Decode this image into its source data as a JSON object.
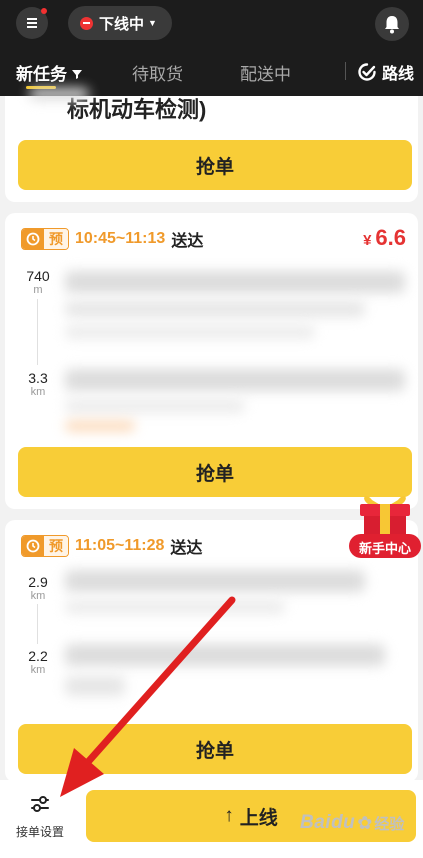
{
  "header": {
    "status_label": "下线中",
    "tabs": [
      "新任务",
      "待取货",
      "配送中"
    ],
    "route_label": "路线"
  },
  "cards": [
    {
      "title_fragment": "标机动车检测)",
      "button_label": "抢单"
    },
    {
      "badge": "预",
      "time_range": "10:45~11:13",
      "time_suffix": "送达",
      "currency": "¥",
      "price": "6.6",
      "distances": [
        {
          "value": "740",
          "unit": "m"
        },
        {
          "value": "3.3",
          "unit": "km"
        }
      ],
      "button_label": "抢单"
    },
    {
      "badge": "预",
      "time_range": "11:05~11:28",
      "time_suffix": "送达",
      "distances": [
        {
          "value": "2.9",
          "unit": "km"
        },
        {
          "value": "2.2",
          "unit": "km"
        }
      ],
      "button_label": "抢单"
    }
  ],
  "gift_label": "新手中心",
  "bottom": {
    "settings_label": "接单设置",
    "online_label": "上线"
  },
  "watermark": {
    "brand": "Baidu",
    "suffix": "经验"
  },
  "colors": {
    "accent_yellow": "#f8cd37",
    "price_red": "#e53333",
    "badge_orange": "#f09a2b",
    "header_bg": "#1c1c1c",
    "annotation_arrow": "#e02020"
  }
}
